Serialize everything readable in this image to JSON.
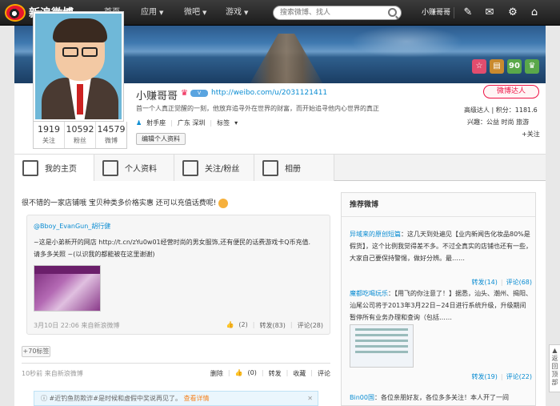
{
  "topbar": {
    "logo_text": "新浪微博",
    "nav": [
      {
        "label": "首页",
        "caret": false
      },
      {
        "label": "应用",
        "caret": true
      },
      {
        "label": "微吧",
        "caret": true
      },
      {
        "label": "游戏",
        "caret": true
      }
    ],
    "search_placeholder": "搜索微博、找人",
    "user_name": "小赚哥哥"
  },
  "profile": {
    "name": "小赚哥哥",
    "url": "http://weibo.com/u/2031121411",
    "badge": "微博达人",
    "bio": "首一个人真正觉醒的一刻，他放弃追寻外在世界的财富，而开始追寻他内心世界的真正",
    "level_line": "高级达人 | 积分：1181.6",
    "interest_line": "兴趣：公益 时尚 旅游",
    "more_link": "+关注",
    "tags": [
      "射手座",
      "广东 深圳",
      "标签"
    ],
    "edit_button": "编辑个人资料",
    "stats": [
      {
        "num": "1919",
        "label": "关注"
      },
      {
        "num": "10592",
        "label": "粉丝"
      },
      {
        "num": "14579",
        "label": "微博"
      }
    ],
    "cover_icons": [
      {
        "name": "star-icon",
        "glyph": "☆",
        "color": "#e14d6e"
      },
      {
        "name": "card-icon",
        "glyph": "▤",
        "color": "#c98a2e"
      },
      {
        "name": "rank-icon",
        "glyph": "90",
        "color": "#5aa84a"
      },
      {
        "name": "crown-icon",
        "glyph": "♛",
        "color": "#5aa84a"
      }
    ]
  },
  "tabs": [
    {
      "label": "我的主页",
      "icon": "home-icon"
    },
    {
      "label": "个人资料",
      "icon": "person-icon"
    },
    {
      "label": "关注/粉丝",
      "icon": "group-icon"
    },
    {
      "label": "相册",
      "icon": "camera-icon"
    }
  ],
  "feed": {
    "promo": "很不错的一家店铺哦 宝贝种类多价格实惠 还可以充值话费呢!",
    "repost": {
      "user": "@Bboy_EvanGun_胡行健",
      "text1": "~这是小弟新开的网店 http://t.cn/zYu0w01经营时尚的男女服饰,还有便民的话费游戏卡Q币充值.",
      "text2": "请多多关照 ~(以识我的都能被在这里谢谢)",
      "time": "3月10日 22:06",
      "source": "来自新浪微博",
      "likes": "(2)",
      "forward": "转发(83)",
      "comment": "评论(28)"
    },
    "tag_button": "+70标签",
    "time": "10秒前",
    "source": "来自新浪微博",
    "actions": [
      "删除",
      "(0)",
      "转发",
      "收藏",
      "评论"
    ],
    "notice": "#近钓鱼防欺诈#是时候和虚假中奖说再见了。",
    "notice_link": "查看详情"
  },
  "sidebar": {
    "title": "推荐微博",
    "items": [
      {
        "author": "异域来的原创短篇",
        "text": "：这几天到处遍见【业内新闻告化妆品80%是假货】，这个比例我觉得差不多。不过全真实的店铺也还有一些，大家自己要保持警惕，做好分辨。最……",
        "forward": "转发(14)",
        "comment": "评论(68)"
      },
      {
        "author": "魔都吃喝玩乐",
        "text": "：【用飞的你注意了！】据悉，汕头、潮州、揭阳、汕尾公司将于2013年3月22日~24日进行系统升级，升级期间暂停所有业务办理和查询（包括……",
        "forward": "转发(19)",
        "comment": "评论(22)"
      },
      {
        "author": "Bin00国",
        "text": "：各位亲朋好友，各位多多关注！本人开了一间",
        "forward": "",
        "comment": ""
      }
    ]
  },
  "float_button": "返回顶部"
}
